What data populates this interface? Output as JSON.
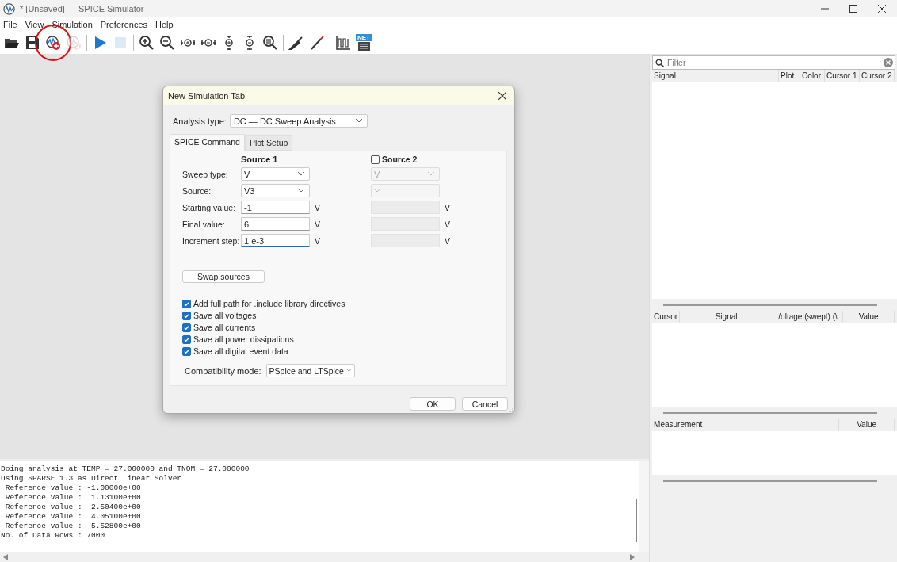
{
  "window": {
    "title": "* [Unsaved] — SPICE Simulator"
  },
  "menu": [
    {
      "label": "File"
    },
    {
      "label": "View"
    },
    {
      "label": "Simulation"
    },
    {
      "label": "Preferences"
    },
    {
      "label": "Help"
    }
  ],
  "toolbar": [
    {
      "kind": "open",
      "disabled": false,
      "highlighted": false
    },
    {
      "kind": "save",
      "disabled": false,
      "highlighted": false
    },
    {
      "kind": "new-sim",
      "disabled": false,
      "highlighted": true
    },
    {
      "kind": "sim-settings",
      "disabled": true,
      "highlighted": false
    },
    {
      "kind": "separator"
    },
    {
      "kind": "run",
      "disabled": false,
      "highlighted": false
    },
    {
      "kind": "stop",
      "disabled": true,
      "highlighted": false
    },
    {
      "kind": "separator"
    },
    {
      "kind": "zoom-in",
      "disabled": false,
      "highlighted": false
    },
    {
      "kind": "zoom-out",
      "disabled": false,
      "highlighted": false
    },
    {
      "kind": "zoom-in-h",
      "disabled": false,
      "highlighted": false
    },
    {
      "kind": "zoom-out-h",
      "disabled": false,
      "highlighted": false
    },
    {
      "kind": "zoom-in-v",
      "disabled": false,
      "highlighted": false
    },
    {
      "kind": "zoom-out-v",
      "disabled": false,
      "highlighted": false
    },
    {
      "kind": "zoom-fit",
      "disabled": false,
      "highlighted": false
    },
    {
      "kind": "separator"
    },
    {
      "kind": "probe",
      "disabled": false,
      "highlighted": false
    },
    {
      "kind": "tuner",
      "disabled": false,
      "highlighted": false
    },
    {
      "kind": "separator"
    },
    {
      "kind": "waveform",
      "disabled": false,
      "highlighted": false
    },
    {
      "kind": "netlist",
      "disabled": false,
      "highlighted": false,
      "badge": "NET"
    }
  ],
  "dialog": {
    "title": "New Simulation Tab",
    "analysis_label": "Analysis type:",
    "analysis_value": "DC — DC Sweep Analysis",
    "tabs": [
      {
        "label": "SPICE Command",
        "selected": true
      },
      {
        "label": "Plot Setup",
        "selected": false
      }
    ],
    "source1": {
      "title": "Source 1"
    },
    "source2": {
      "title": "Source 2",
      "checked": false
    },
    "rows": [
      {
        "label": "Sweep type:",
        "kind": "select",
        "value1": "V",
        "value2": "V"
      },
      {
        "label": "Source:",
        "kind": "select",
        "value1": "V3",
        "value2": ""
      },
      {
        "label": "Starting value:",
        "kind": "input",
        "value1": "-1",
        "value2": "",
        "unit1": "V",
        "unit2": "V"
      },
      {
        "label": "Final value:",
        "kind": "input",
        "value1": "6",
        "value2": "",
        "unit1": "V",
        "unit2": "V"
      },
      {
        "label": "Increment step:",
        "kind": "input",
        "value1": "1.e-3",
        "value2": "",
        "unit1": "V",
        "unit2": "V",
        "focused": true
      }
    ],
    "swap_button": "Swap sources",
    "options": [
      {
        "label": "Add full path for .include library directives",
        "checked": true
      },
      {
        "label": "Save all voltages",
        "checked": true
      },
      {
        "label": "Save all currents",
        "checked": true
      },
      {
        "label": "Save all power dissipations",
        "checked": true
      },
      {
        "label": "Save all digital event data",
        "checked": true
      }
    ],
    "compat_label": "Compatibility mode:",
    "compat_value": "PSpice and LTSpice",
    "buttons": [
      "OK",
      "Cancel"
    ]
  },
  "log": [
    "Doing analysis at TEMP = 27.000000 and TNOM = 27.000000",
    "Using SPARSE 1.3 as Direct Linear Solver",
    " Reference value : -1.00000e+00",
    " Reference value :  1.13100e+00",
    " Reference value :  2.50400e+00",
    " Reference value :  4.05100e+00",
    " Reference value :  5.52800e+00",
    "No. of Data Rows : 7000"
  ],
  "signals": {
    "filter_placeholder": "Filter",
    "columns": [
      "Signal",
      "Plot",
      "Color",
      "Cursor 1",
      "Cursor 2"
    ]
  },
  "cursors": {
    "columns": [
      "Cursor",
      "Signal",
      "/oltage (swept) (\\",
      "Value"
    ]
  },
  "measurements": {
    "columns": [
      "Measurement",
      "Value"
    ]
  }
}
